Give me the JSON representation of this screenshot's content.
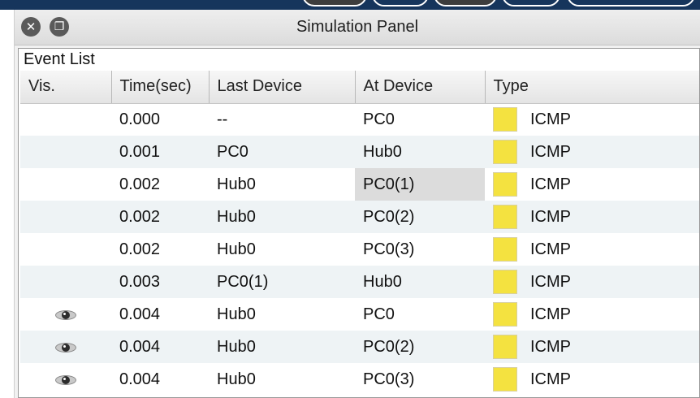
{
  "window": {
    "title": "Simulation Panel",
    "close_icon": "close-icon",
    "restore_icon": "restore-icon"
  },
  "event_list": {
    "title": "Event List",
    "columns": [
      "Vis.",
      "Time(sec)",
      "Last Device",
      "At Device",
      "Type"
    ],
    "type_color": "#f4e240",
    "rows": [
      {
        "vis": false,
        "time": "0.000",
        "last_device": "--",
        "at_device": "PC0",
        "type": "ICMP"
      },
      {
        "vis": false,
        "time": "0.001",
        "last_device": "PC0",
        "at_device": "Hub0",
        "type": "ICMP"
      },
      {
        "vis": false,
        "time": "0.002",
        "last_device": "Hub0",
        "at_device": "PC0(1)",
        "type": "ICMP",
        "selected": true
      },
      {
        "vis": false,
        "time": "0.002",
        "last_device": "Hub0",
        "at_device": "PC0(2)",
        "type": "ICMP"
      },
      {
        "vis": false,
        "time": "0.002",
        "last_device": "Hub0",
        "at_device": "PC0(3)",
        "type": "ICMP"
      },
      {
        "vis": false,
        "time": "0.003",
        "last_device": "PC0(1)",
        "at_device": "Hub0",
        "type": "ICMP"
      },
      {
        "vis": true,
        "time": "0.004",
        "last_device": "Hub0",
        "at_device": "PC0",
        "type": "ICMP"
      },
      {
        "vis": true,
        "time": "0.004",
        "last_device": "Hub0",
        "at_device": "PC0(2)",
        "type": "ICMP"
      },
      {
        "vis": true,
        "time": "0.004",
        "last_device": "Hub0",
        "at_device": "PC0(3)",
        "type": "ICMP"
      }
    ]
  }
}
